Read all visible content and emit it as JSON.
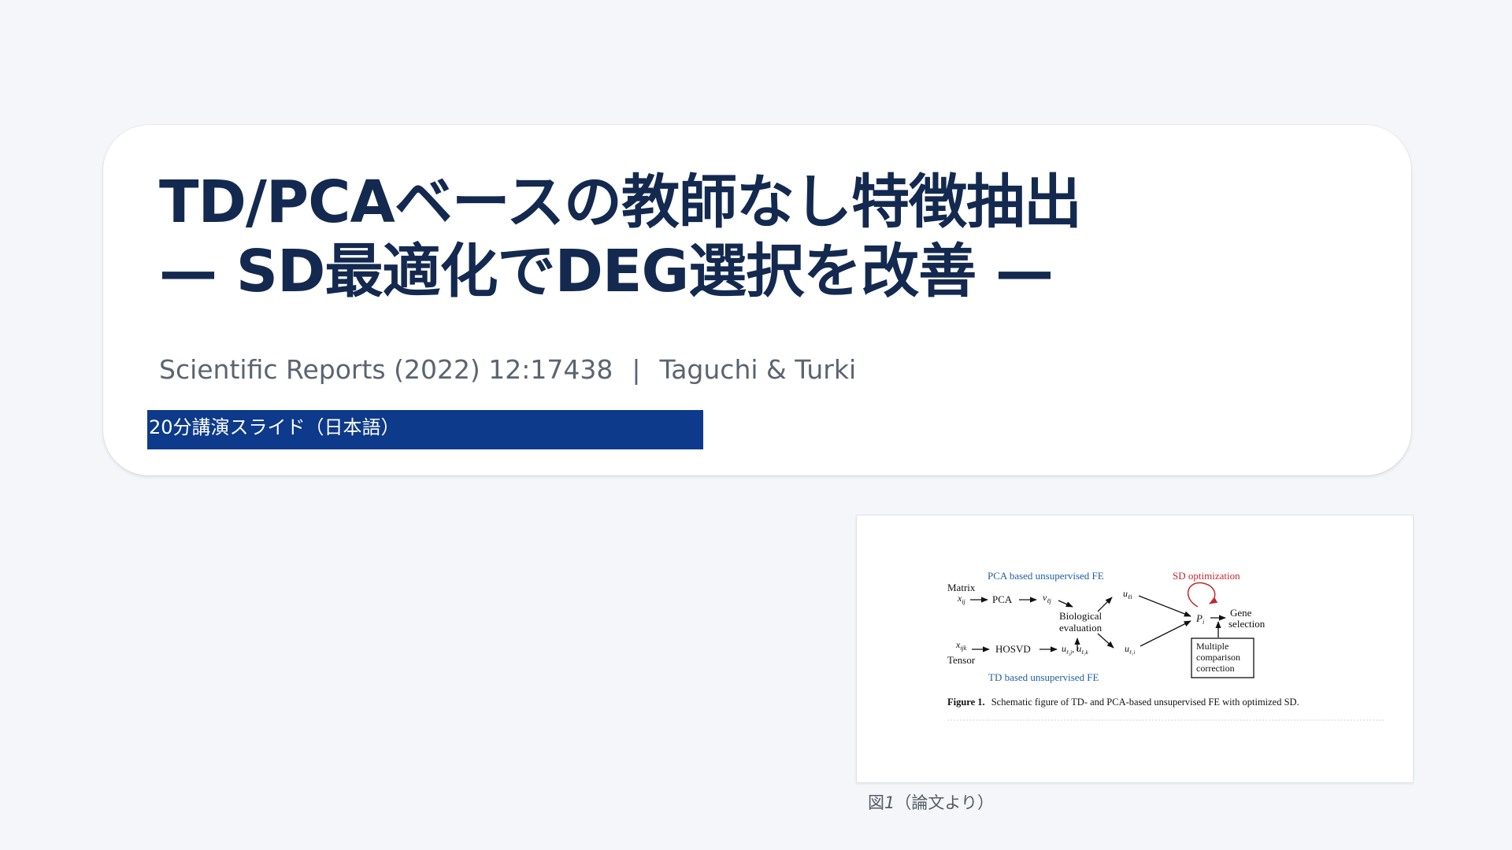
{
  "title": {
    "line1": "TD/PCAベースの教師なし特徴抽出",
    "line2": "— SD最適化でDEG選択を改善 —"
  },
  "citation": {
    "source": "Scientific Reports (2022) 12:17438",
    "separator": "|",
    "authors": "Taguchi & Turki"
  },
  "badge": "20分講演スライド（日本語）",
  "figure": {
    "labels": {
      "pca_fe": "PCA based unsupervised FE",
      "sd_opt": "SD optimization",
      "matrix": "Matrix",
      "x_ij": "x",
      "x_ij_sub": "ij",
      "pca": "PCA",
      "v_lj": "v",
      "v_lj_sub": "ℓj",
      "u_li": "u",
      "u_li_sub": "ℓi",
      "p_i": "P",
      "p_i_sub": "i",
      "gene": "Gene",
      "selection": "selection",
      "biological": "Biological",
      "evaluation": "evaluation",
      "x_ijk": "x",
      "x_ijk_sub": "ijk",
      "hosvd": "HOSVD",
      "u_l2j": "u",
      "u_l2j_sub": "ℓ₂j",
      "u_l3k": "u",
      "u_l3k_sub": "ℓ₃k",
      "u_l1i": "u",
      "u_l1i_sub": "ℓ₁i",
      "tensor": "Tensor",
      "td_fe": "TD based unsupervised FE",
      "multiple": "Multiple",
      "comparison": "comparison",
      "correction": "correction",
      "fig_bold": "Figure 1.",
      "fig_text": "Schematic figure of TD- and PCA-based unsupervised FE with optimized SD."
    },
    "colors": {
      "blue_label": "#1f5fa0",
      "red_label": "#c0282d",
      "ink": "#111111"
    }
  },
  "figure_caption": {
    "prefix": "図",
    "number": "1",
    "suffix": "（論文より）"
  }
}
